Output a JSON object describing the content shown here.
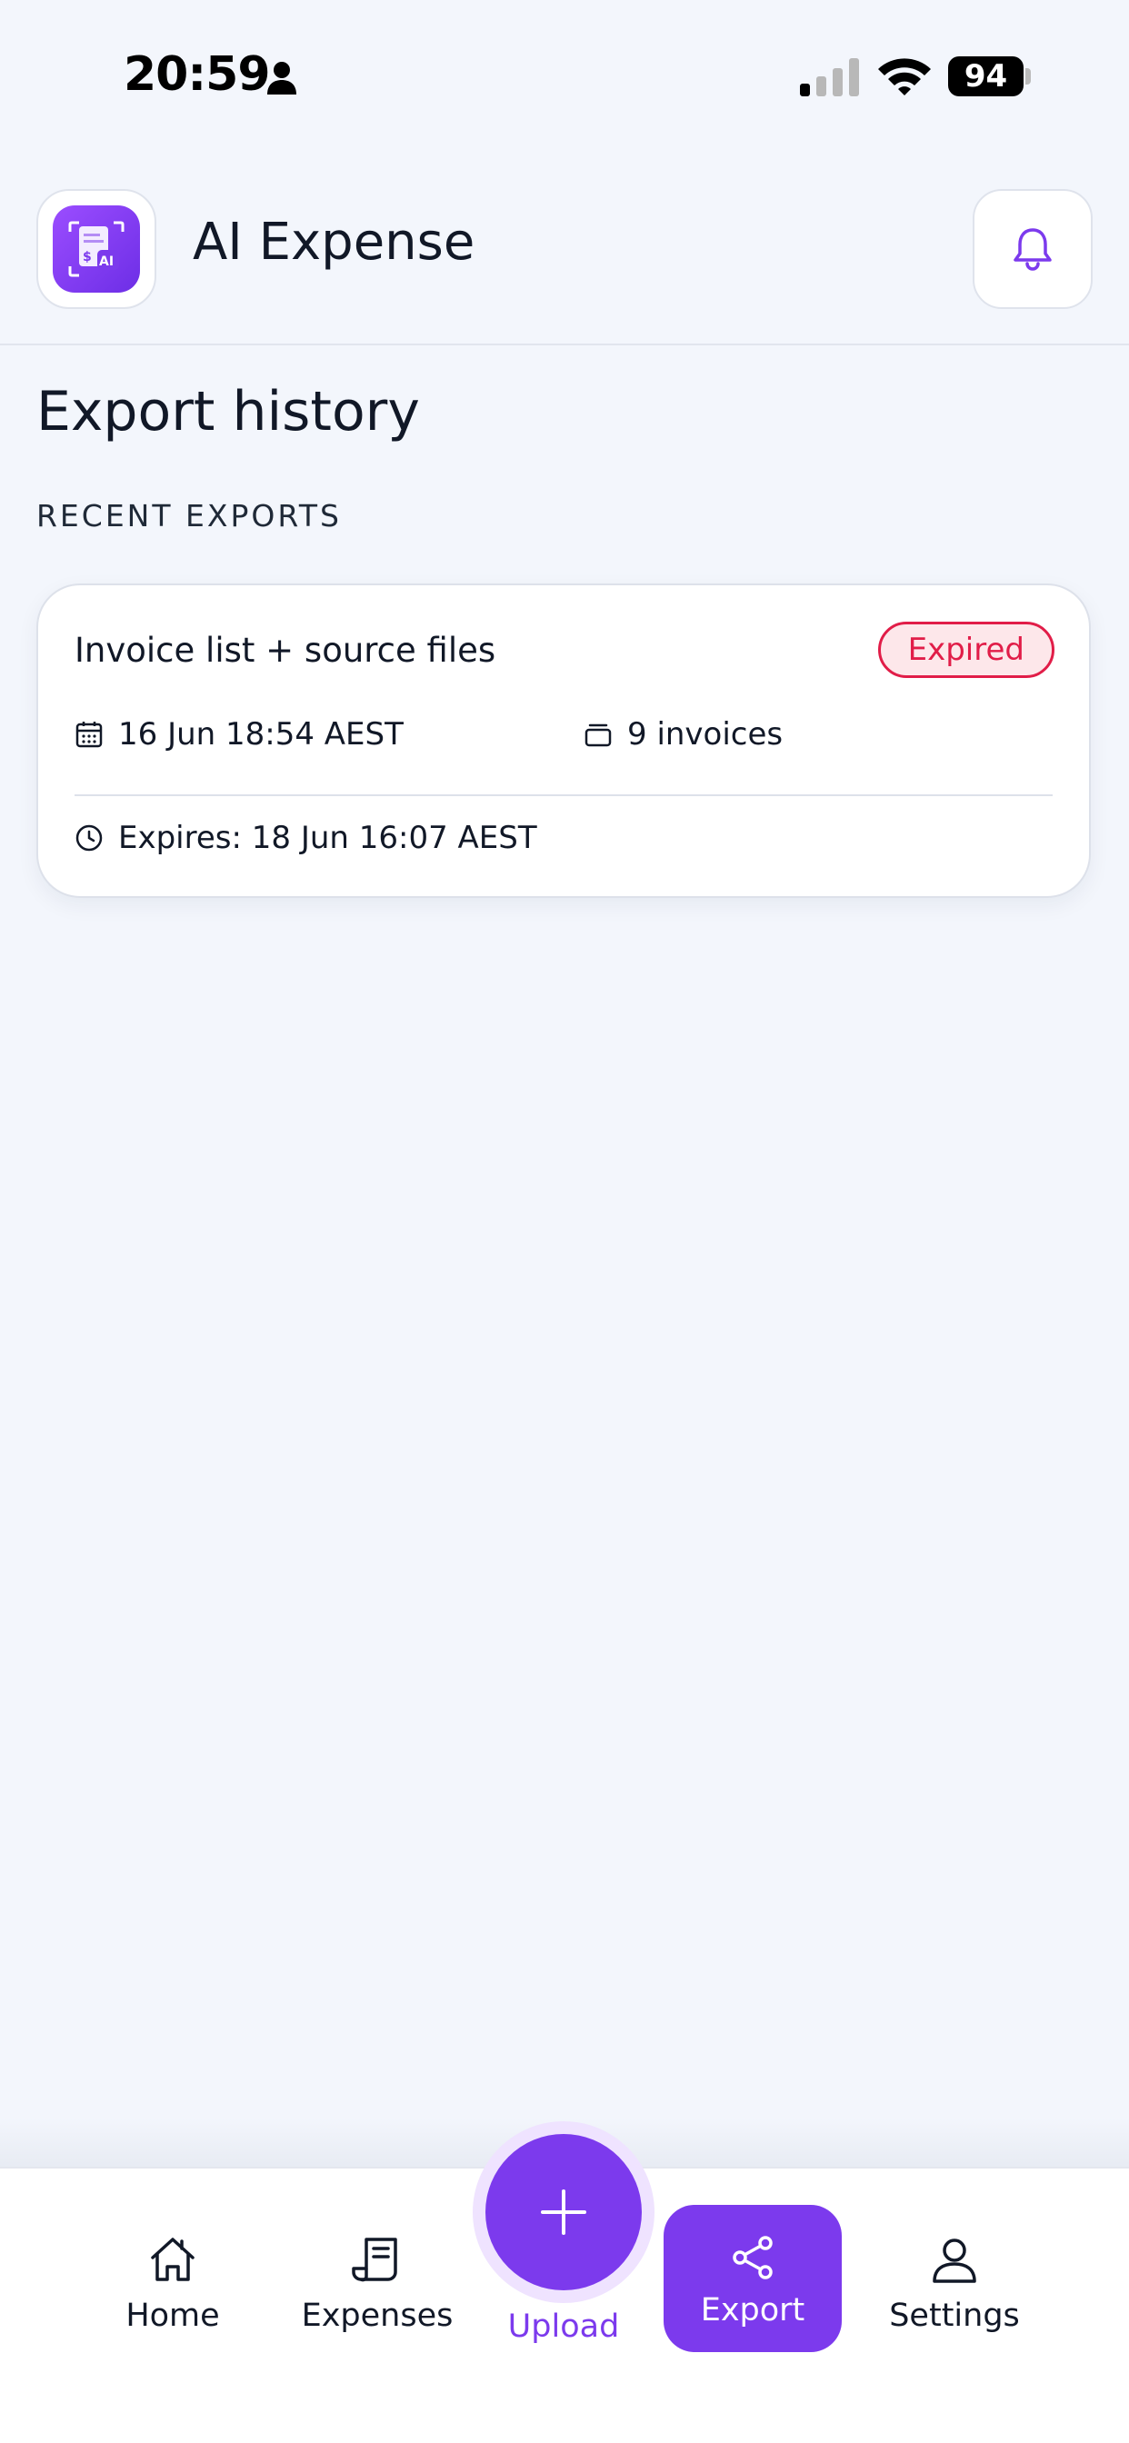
{
  "status_bar": {
    "time": "20:59",
    "battery": "94"
  },
  "header": {
    "app_name": "AI Expense",
    "logo_icon": "receipt-ai-icon",
    "bell_icon": "bell-icon"
  },
  "page": {
    "title": "Export history",
    "section_label": "RECENT EXPORTS"
  },
  "exports": [
    {
      "title": "Invoice list + source files",
      "status": "Expired",
      "date": "16 Jun 18:54 AEST",
      "count": "9 invoices",
      "expires": "Expires: 18 Jun 16:07 AEST"
    }
  ],
  "nav": {
    "home": "Home",
    "expenses": "Expenses",
    "upload": "Upload",
    "export": "Export",
    "settings": "Settings"
  },
  "colors": {
    "accent": "#7c3aed",
    "expired": "#e11d48",
    "background": "#f3f6fc"
  }
}
